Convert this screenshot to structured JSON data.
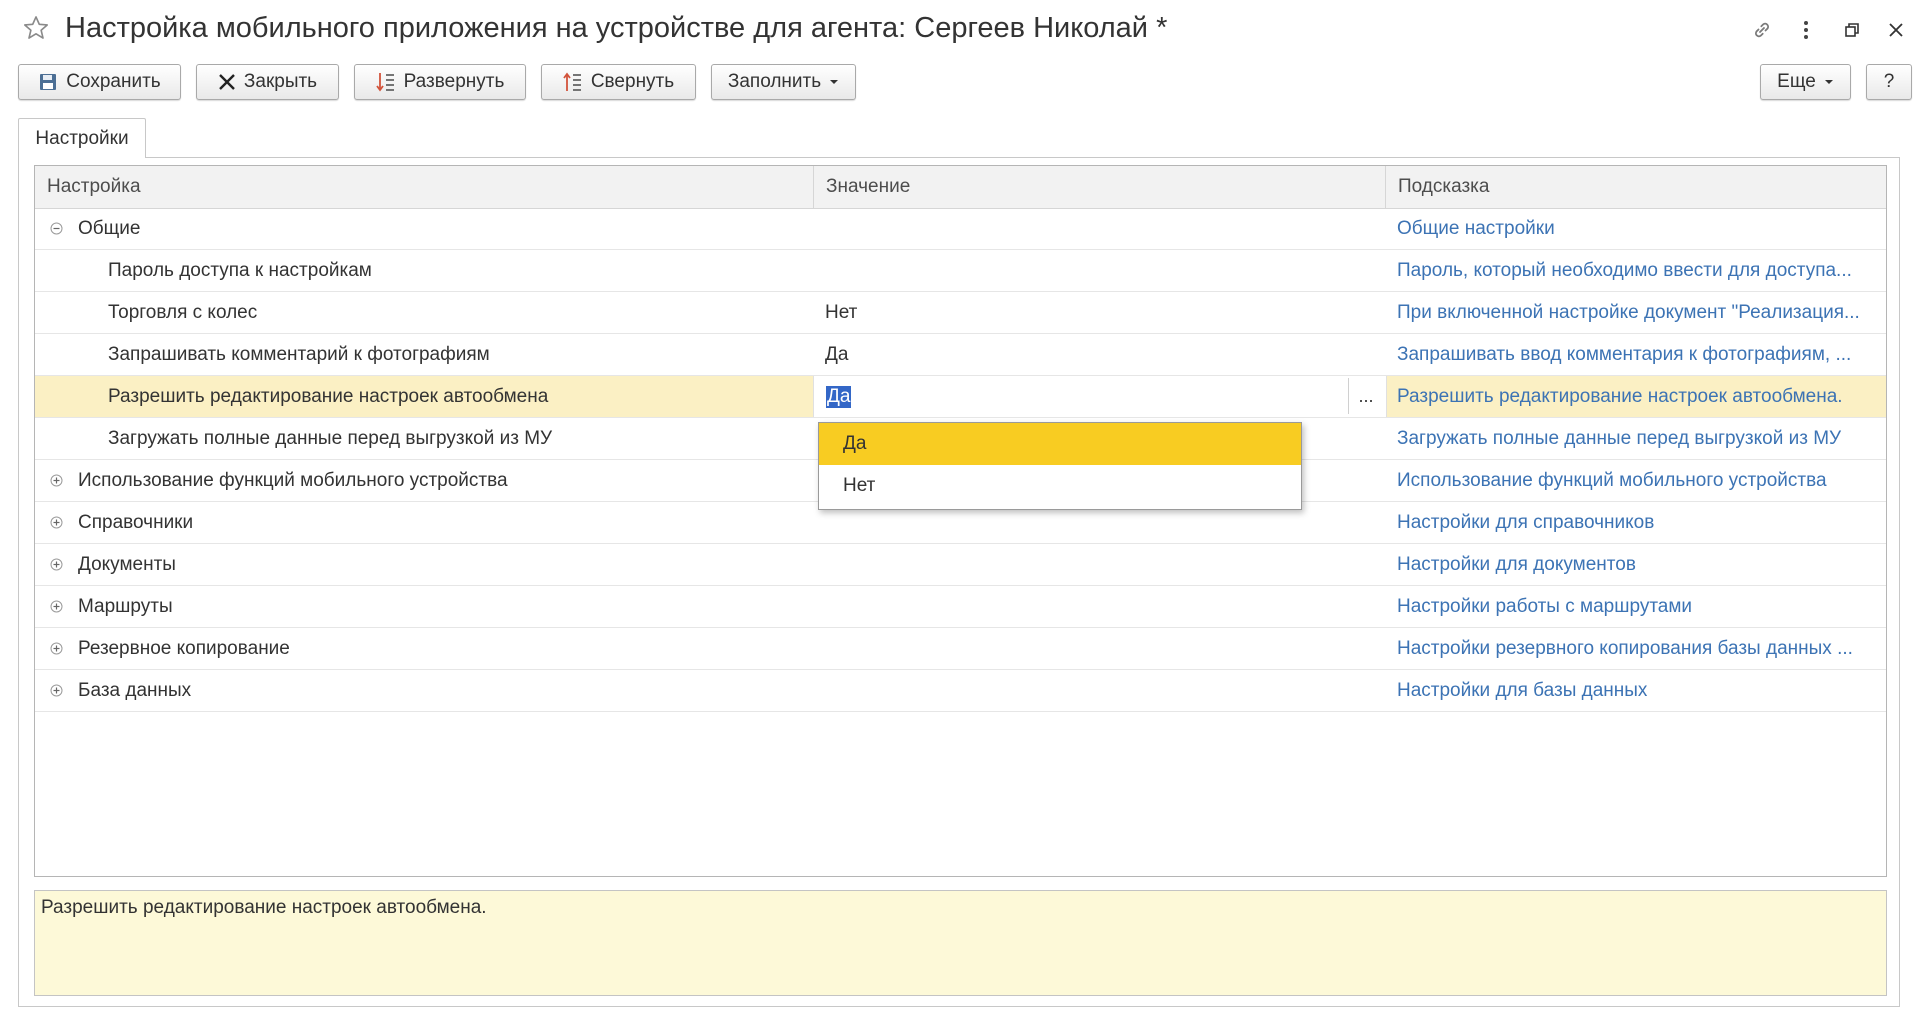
{
  "window": {
    "title": "Настройка мобильного приложения на устройстве для агента: Сергеев Николай *"
  },
  "toolbar": {
    "save": "Сохранить",
    "close": "Закрыть",
    "expand": "Развернуть",
    "collapse": "Свернуть",
    "fill": "Заполнить",
    "more": "Еще",
    "help": "?"
  },
  "tabs": {
    "settings": "Настройки"
  },
  "grid": {
    "columns": {
      "setting": "Настройка",
      "value": "Значение",
      "hint": "Подсказка"
    },
    "rows": [
      {
        "level": 0,
        "expander": "minus",
        "setting": "Общие",
        "value": "",
        "hint": "Общие настройки"
      },
      {
        "level": 1,
        "expander": "",
        "setting": "Пароль доступа к настройкам",
        "value": "",
        "hint": "Пароль, который необходимо ввести для доступа..."
      },
      {
        "level": 1,
        "expander": "",
        "setting": "Торговля с колес",
        "value": "Нет",
        "hint": "При включенной настройке документ \"Реализация..."
      },
      {
        "level": 1,
        "expander": "",
        "setting": "Запрашивать комментарий к фотографиям",
        "value": "Да",
        "hint": "Запрашивать ввод комментария к фотографиям, ..."
      },
      {
        "level": 1,
        "expander": "",
        "setting": "Разрешить редактирование настроек автообмена",
        "value": "Да",
        "hint": "Разрешить редактирование настроек автообмена.",
        "selected": true
      },
      {
        "level": 1,
        "expander": "",
        "setting": "Загружать полные данные перед выгрузкой из МУ",
        "value": "",
        "hint": "Загружать полные данные перед выгрузкой из МУ"
      },
      {
        "level": 0,
        "expander": "plus",
        "setting": "Использование функций мобильного устройства",
        "value": "",
        "hint": "Использование функций мобильного устройства"
      },
      {
        "level": 0,
        "expander": "plus",
        "setting": "Справочники",
        "value": "",
        "hint": "Настройки для справочников"
      },
      {
        "level": 0,
        "expander": "plus",
        "setting": "Документы",
        "value": "",
        "hint": "Настройки для документов"
      },
      {
        "level": 0,
        "expander": "plus",
        "setting": "Маршруты",
        "value": "",
        "hint": "Настройки работы с маршрутами"
      },
      {
        "level": 0,
        "expander": "plus",
        "setting": "Резервное копирование",
        "value": "",
        "hint": "Настройки резервного копирования базы данных ..."
      },
      {
        "level": 0,
        "expander": "plus",
        "setting": "База данных",
        "value": "",
        "hint": "Настройки для базы данных"
      }
    ]
  },
  "editor": {
    "value": "Да",
    "choice_button": "..."
  },
  "dropdown": {
    "options": [
      "Да",
      "Нет"
    ],
    "highlighted": 0
  },
  "hint_area": {
    "text": "Разрешить редактирование настроек автообмена."
  },
  "colors": {
    "hint_link": "#3c73b4",
    "selected_row": "#fbf0c4",
    "dropdown_highlight": "#f8cc22",
    "hint_area_bg": "#fdf9d8"
  }
}
